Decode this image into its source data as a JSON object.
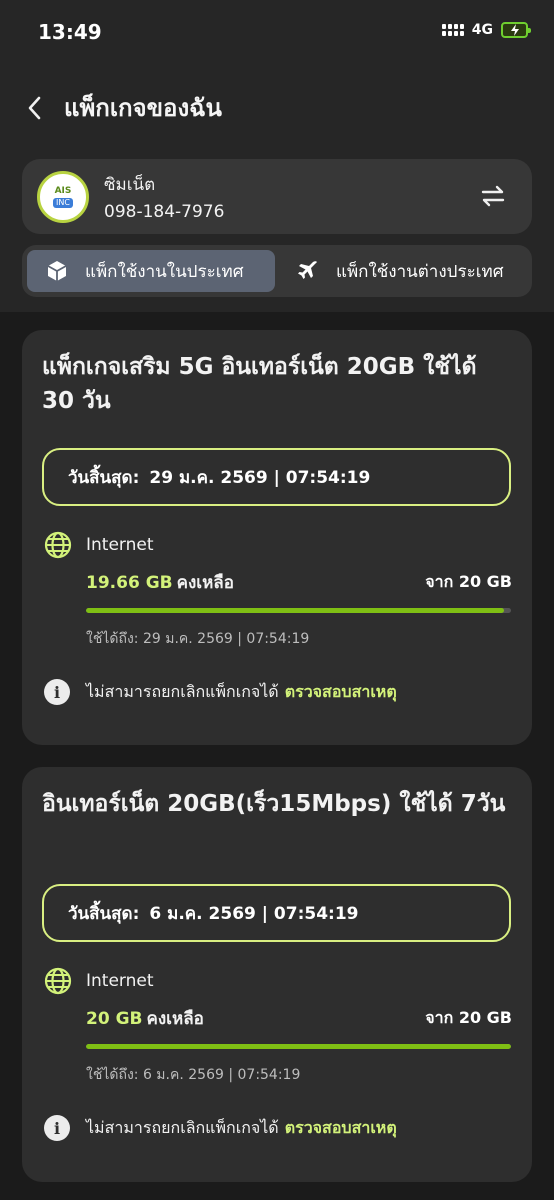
{
  "status": {
    "time": "13:49",
    "network": "4G"
  },
  "header": {
    "title": "แพ็กเกจของฉัน"
  },
  "sim": {
    "name": "ซิมเน็ต",
    "number": "098-184-7976",
    "logo_top": "AIS",
    "logo_bottom": "INC"
  },
  "tabs": [
    {
      "label": "แพ็กใช้งานในประเทศ",
      "icon": "box-icon",
      "active": true
    },
    {
      "label": "แพ็กใช้งานต่างประเทศ",
      "icon": "airplane-icon",
      "active": false
    }
  ],
  "packages": [
    {
      "title": "แพ็กเกจเสริม 5G อินเทอร์เน็ต 20GB ใช้ได้ 30 วัน",
      "expiry_label": "วันสิ้นสุด:",
      "expiry_value": "29 ม.ค. 2569 | 07:54:19",
      "service": "Internet",
      "remaining_value": "19.66 GB",
      "remaining_label": "คงเหลือ",
      "total": "จาก 20 GB",
      "remaining_fraction": 0.983,
      "valid_until": "ใช้ได้ถึง: 29 ม.ค. 2569 | 07:54:19",
      "notice": "ไม่สามารถยกเลิกแพ็กเกจได้",
      "notice_link": "ตรวจสอบสาเหตุ"
    },
    {
      "title": "อินเทอร์เน็ต 20GB(เร็ว15Mbps) ใช้ได้ 7วัน",
      "expiry_label": "วันสิ้นสุด:",
      "expiry_value": "6 ม.ค. 2569 | 07:54:19",
      "service": "Internet",
      "remaining_value": "20 GB",
      "remaining_label": "คงเหลือ",
      "total": "จาก 20 GB",
      "remaining_fraction": 1.0,
      "valid_until": "ใช้ได้ถึง: 6 ม.ค. 2569 | 07:54:19",
      "notice": "ไม่สามารถยกเลิกแพ็กเกจได้",
      "notice_link": "ตรวจสอบสาเหตุ"
    }
  ],
  "colors": {
    "accent": "#d3f27a",
    "bar_fill": "#7fbf14",
    "active_tab": "#5c6473"
  }
}
